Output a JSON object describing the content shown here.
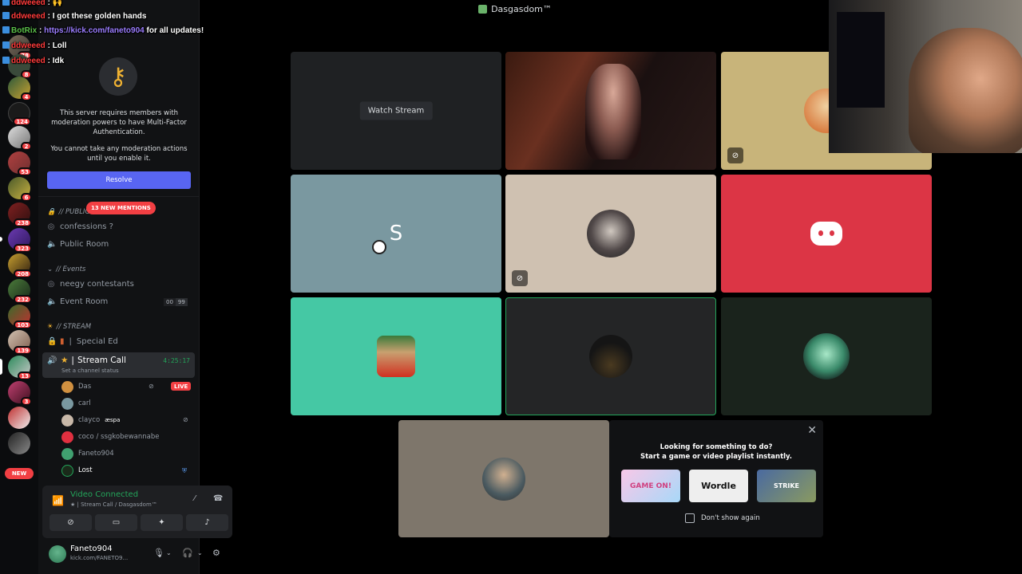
{
  "window": {
    "title": "Dasgasdom™"
  },
  "chat": {
    "lines": [
      {
        "user": "ddweeed",
        "message": "🙌"
      },
      {
        "user": "ddweeed",
        "message": "I got these golden hands"
      },
      {
        "user": "BotRix",
        "message": "https://kick.com/faneto904",
        "suffix": "for all updates!"
      },
      {
        "user": "ddweeed",
        "message": "Loll"
      },
      {
        "user": "ddweeed",
        "message": "Idk"
      }
    ]
  },
  "rail": {
    "badges": [
      "78",
      "8",
      "4",
      "124",
      "2",
      "53",
      "6",
      "238",
      "323",
      "208",
      "232",
      "103",
      "139",
      "13",
      "3"
    ],
    "new_label": "NEW"
  },
  "sidebar": {
    "server_name": "Dasgasdom™",
    "mfa": {
      "line1": "This server requires members with moderation powers to have Multi-Factor Authentication.",
      "line2": "You cannot take any moderation actions until you enable it.",
      "resolve": "Resolve"
    },
    "mentions": "13 NEW MENTIONS",
    "categories": {
      "public": "// PUBLIC",
      "events": "// Events",
      "stream": "// STREAM"
    },
    "channels": {
      "confessions": "confessions ?",
      "public_room": "Public Room",
      "neegy": "neegy contestants",
      "event_room": "Event Room",
      "event_count_a": "00",
      "event_count_b": "99",
      "special_ed": "Special Ed",
      "stream_call": "Stream Call",
      "stream_status": "Set a channel status",
      "stream_timer": "4:25:17"
    },
    "voice_users": [
      {
        "name": "Das",
        "live": "LIVE"
      },
      {
        "name": "carl"
      },
      {
        "name": "clayco",
        "tag": "æspa"
      },
      {
        "name": "coco / ssgkobewannabe"
      },
      {
        "name": "Faneto904"
      },
      {
        "name": "Lost"
      }
    ]
  },
  "voice_panel": {
    "title": "Video Connected",
    "subtitle": "Stream Call / Dasgasdom™"
  },
  "user_bar": {
    "name": "Faneto904",
    "status": "kick.com/FANETO9..."
  },
  "stage": {
    "watch_stream": "Watch Stream",
    "tile_letter": "S",
    "activity": {
      "title1": "Looking for something to do?",
      "title2": "Start a game or video playlist instantly.",
      "cards": [
        "GAME ON!",
        "Wordle",
        "STRIKE"
      ],
      "dont_show": "Don't show again"
    }
  },
  "colors": {
    "accent": "#5865f2",
    "danger": "#f23f43",
    "online": "#23a55a"
  }
}
